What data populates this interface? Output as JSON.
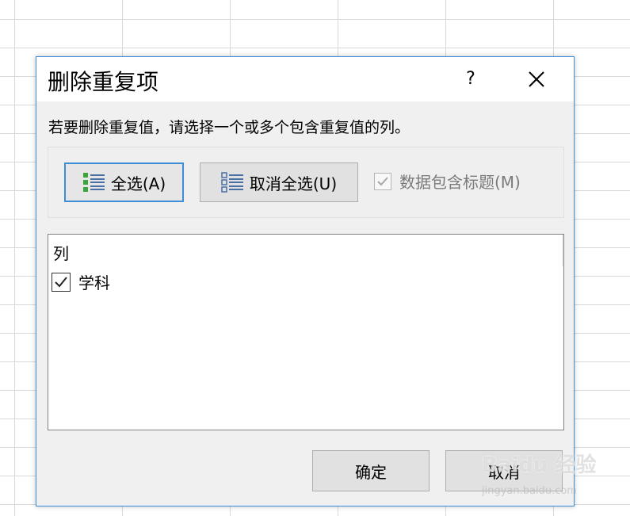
{
  "dialog": {
    "title": "删除重复项",
    "help_label": "?",
    "description": "若要删除重复值，请选择一个或多个包含重复值的列。"
  },
  "toolbar": {
    "select_all_label": "全选(A)",
    "unselect_all_label": "取消全选(U)",
    "headers_checkbox_label": "数据包含标题(M)",
    "headers_checked": true
  },
  "columns_list": {
    "header": "列",
    "items": [
      {
        "label": "学科",
        "checked": true
      }
    ]
  },
  "footer": {
    "ok_label": "确定",
    "cancel_label": "取消"
  },
  "watermark": {
    "main": "Baidu 经验",
    "sub": "jingyan.baidu.com"
  },
  "colors": {
    "accent": "#3c8ed8",
    "dialog_bg": "#f0f0f0",
    "button_bg": "#e1e1e1"
  }
}
